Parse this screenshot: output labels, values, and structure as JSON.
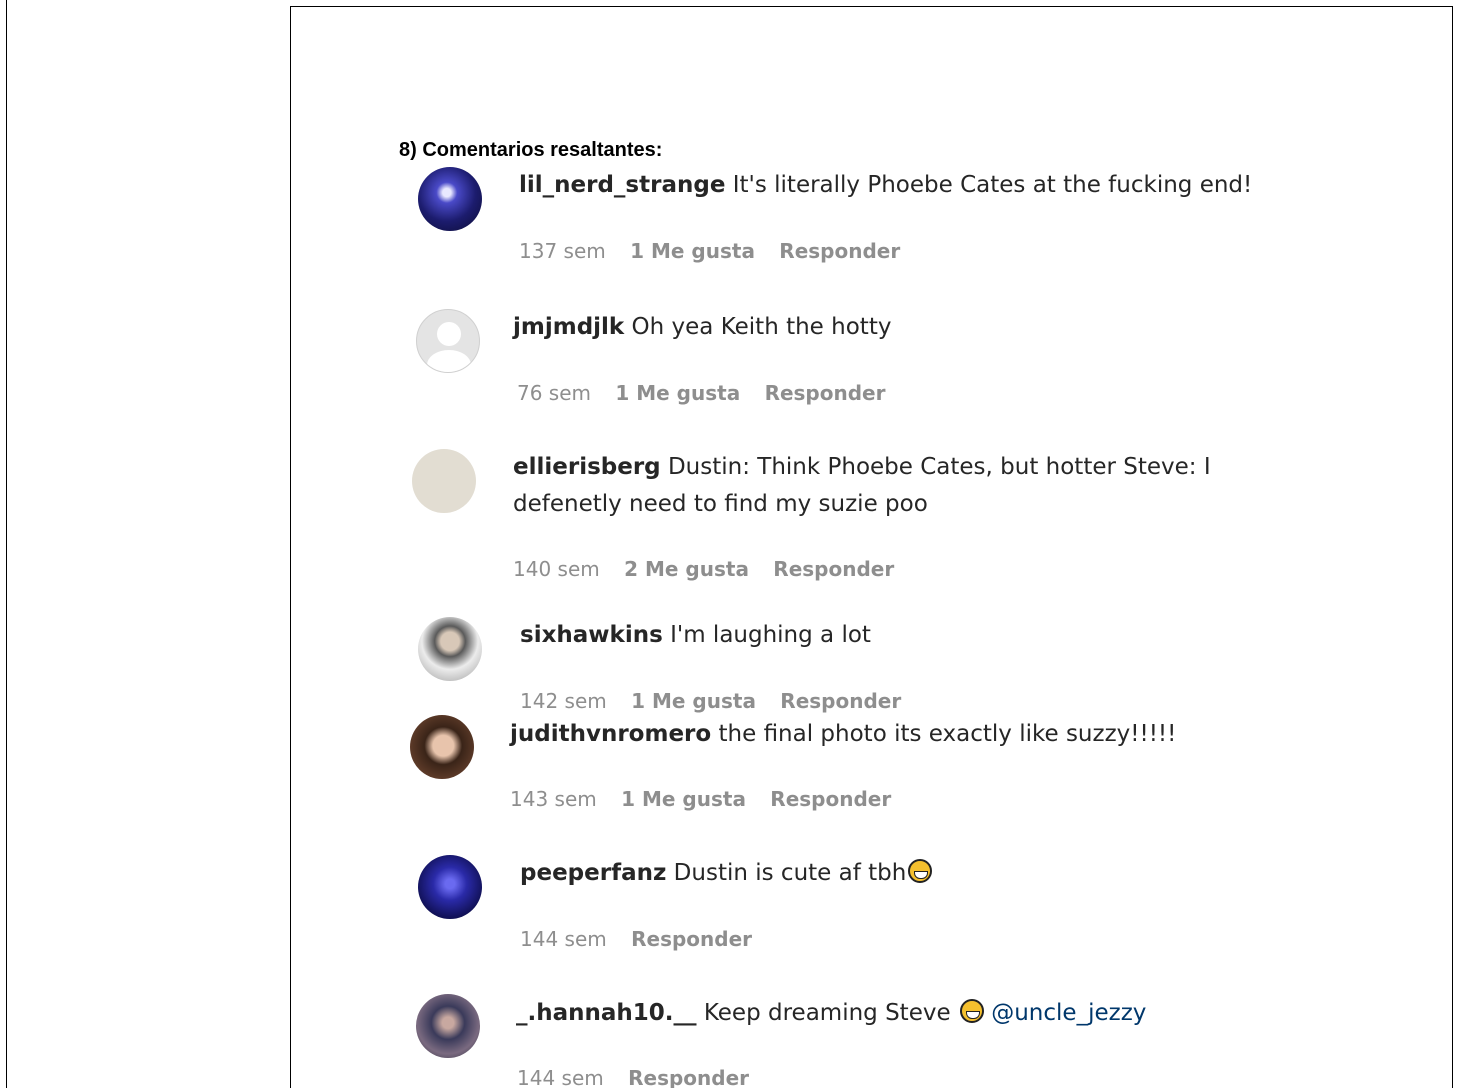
{
  "heading": "8) Comentarios resaltantes:",
  "comments": [
    {
      "username": "lil_nerd_strange",
      "text": "It's literally Phoebe Cates at the fucking end!",
      "time": "137 sem",
      "likes": "1 Me gusta",
      "reply": "Responder"
    },
    {
      "username": "jmjmdjlk",
      "text": "Oh yea Keith the hotty",
      "time": "76 sem",
      "likes": "1 Me gusta",
      "reply": "Responder"
    },
    {
      "username": "ellierisberg",
      "text": "Dustin: Think Phoebe Cates, but hotter Steve: I",
      "text2": "defenetly need to find my suzie poo",
      "time": "140 sem",
      "likes": "2 Me gusta",
      "reply": "Responder"
    },
    {
      "username": "sixhawkins",
      "text": "I'm laughing a lot",
      "time": "142 sem",
      "likes": "1 Me gusta",
      "reply": "Responder"
    },
    {
      "username": "judithvnromero",
      "text": "the final photo its exactly like suzzy!!!!!",
      "time": "143 sem",
      "likes": "1 Me gusta",
      "reply": "Responder"
    },
    {
      "username": "peeperfanz",
      "text": "Dustin is cute af tbh",
      "time": "144 sem",
      "reply": "Responder"
    },
    {
      "username": "_.hannah10.__",
      "text": "Keep dreaming Steve",
      "mention": "@uncle_jezzy",
      "time": "144 sem",
      "reply": "Responder"
    }
  ],
  "colors": {
    "text": "#262626",
    "meta": "#8e8e8e",
    "mention": "#00376b"
  },
  "icons": [
    "avatar-galaxy",
    "avatar-default",
    "avatar-beige",
    "avatar-photo",
    "avatar-photo",
    "avatar-night",
    "avatar-photo",
    "grinning-emoji"
  ]
}
